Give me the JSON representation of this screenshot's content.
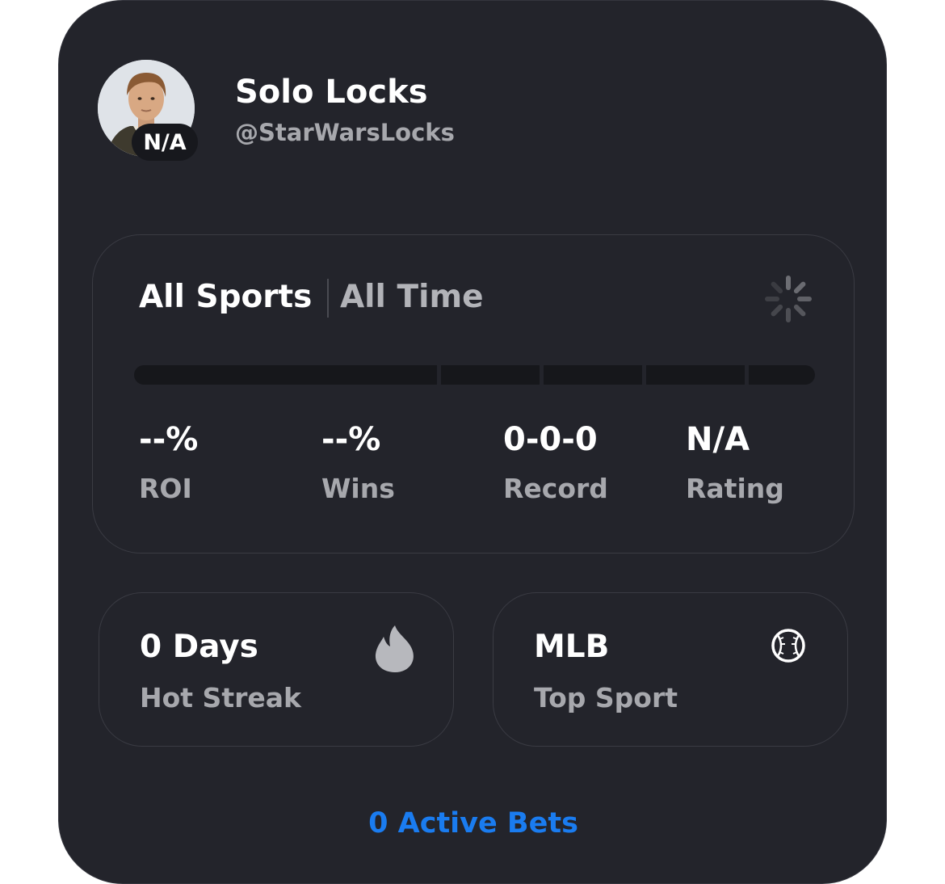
{
  "profile": {
    "name": "Solo Locks",
    "handle": "@StarWarsLocks",
    "rank_badge": "N/A",
    "avatar": "profile-photo"
  },
  "filters": {
    "sport": "All Sports",
    "time": "All Time",
    "loading_indicator": "spinner-icon"
  },
  "stats": [
    {
      "value": "--%",
      "label": "ROI"
    },
    {
      "value": "--%",
      "label": "Wins"
    },
    {
      "value": "0-0-0",
      "label": "Record"
    },
    {
      "value": "N/A",
      "label": "Rating"
    }
  ],
  "tiles": {
    "streak": {
      "value": "0 Days",
      "label": "Hot Streak",
      "icon": "flame-icon"
    },
    "sport": {
      "value": "MLB",
      "label": "Top Sport",
      "icon": "baseball-icon"
    }
  },
  "footer": {
    "active_bets": "0 Active Bets"
  },
  "colors": {
    "card_bg": "#23242b",
    "text_primary": "#ffffff",
    "text_secondary": "#a7a8ad",
    "accent": "#1a7cf0"
  }
}
